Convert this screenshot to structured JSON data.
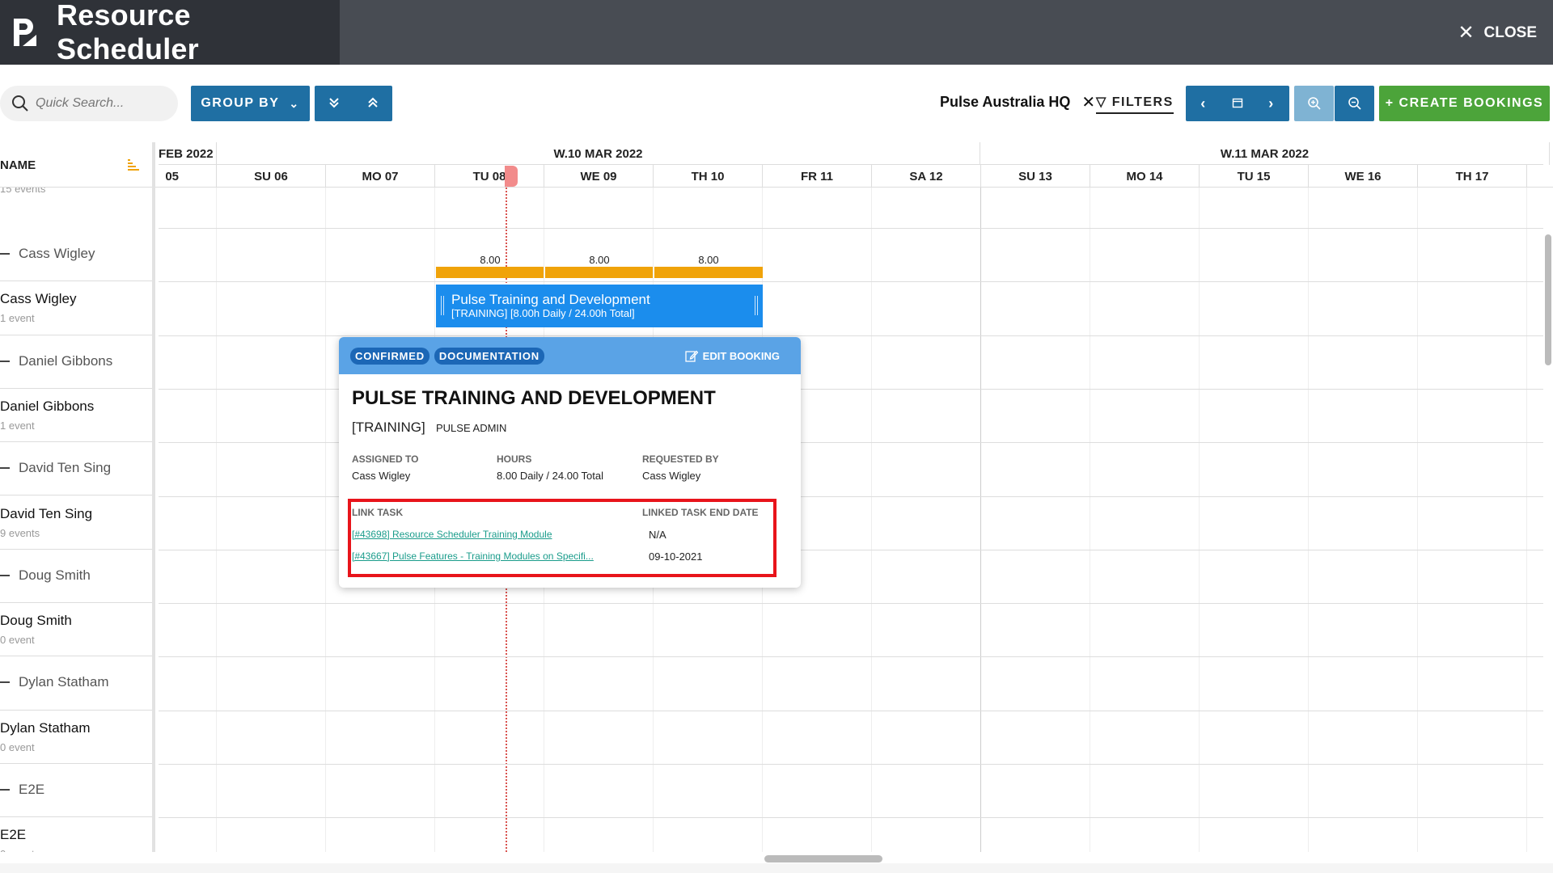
{
  "header": {
    "title": "Resource Scheduler",
    "close_label": "CLOSE"
  },
  "toolbar": {
    "search_placeholder": "Quick Search...",
    "group_by_label": "GROUP BY",
    "location_filter": "Pulse Australia HQ",
    "filters_label": "FILTERS",
    "create_label": "+ CREATE BOOKINGS"
  },
  "grid": {
    "name_header": "NAME",
    "months": [
      {
        "label": "FEB 2022"
      },
      {
        "label": "W.10 MAR 2022"
      },
      {
        "label": "W.11 MAR 2022"
      }
    ],
    "days": [
      "  05",
      "SU 06",
      "MO 07",
      "TU 08",
      "WE 09",
      "TH 10",
      "FR 11",
      "SA 12",
      "SU 13",
      "MO 14",
      "TU 15",
      "WE 16",
      "TH 17"
    ],
    "top_partial_count": "15 events",
    "rows": [
      {
        "kind": "group",
        "name": "Cass Wigley"
      },
      {
        "kind": "resource",
        "name": "Cass Wigley",
        "count": "1 event"
      },
      {
        "kind": "group",
        "name": "Daniel Gibbons"
      },
      {
        "kind": "resource",
        "name": "Daniel Gibbons",
        "count": "1 event"
      },
      {
        "kind": "group",
        "name": "David Ten Sing"
      },
      {
        "kind": "resource",
        "name": "David Ten Sing",
        "count": "9 events"
      },
      {
        "kind": "group",
        "name": "Doug Smith"
      },
      {
        "kind": "resource",
        "name": "Doug Smith",
        "count": "0 event"
      },
      {
        "kind": "group",
        "name": "Dylan Statham"
      },
      {
        "kind": "resource",
        "name": "Dylan Statham",
        "count": "0 event"
      },
      {
        "kind": "group",
        "name": "E2E"
      },
      {
        "kind": "resource",
        "name": "E2E",
        "count": "0 event"
      }
    ]
  },
  "booking": {
    "daily_hours": [
      "8.00",
      "8.00",
      "8.00"
    ],
    "title": "Pulse Training and Development",
    "subtitle": "[TRAINING] [8.00h Daily / 24.00h Total]"
  },
  "popup": {
    "tags": [
      "CONFIRMED",
      "DOCUMENTATION"
    ],
    "edit_label": "EDIT BOOKING",
    "title": "PULSE TRAINING AND DEVELOPMENT",
    "type": "[TRAINING]",
    "owner": "PULSE ADMIN",
    "assigned_to_label": "ASSIGNED TO",
    "assigned_to": "Cass Wigley",
    "hours_label": "HOURS",
    "hours": "8.00 Daily / 24.00 Total",
    "requested_by_label": "REQUESTED BY",
    "requested_by": "Cass Wigley",
    "link_task_label": "LINK TASK",
    "end_date_label": "LINKED TASK END DATE",
    "tasks": [
      {
        "link": "[#43698] Resource Scheduler Training Module",
        "end_date": "N/A"
      },
      {
        "link": "[#43667] Pulse Features  - Training Modules on Specifi...",
        "end_date": "09-10-2021"
      }
    ]
  },
  "colors": {
    "header_dark": "#2f3238",
    "header": "#484c53",
    "primary_button": "#1f6fa3",
    "create_button": "#4ca43a",
    "booking_bar": "#1b8ded",
    "hours_bar": "#f0a30a",
    "popup_header": "#5aa3e6",
    "highlight": "#e8141b"
  }
}
